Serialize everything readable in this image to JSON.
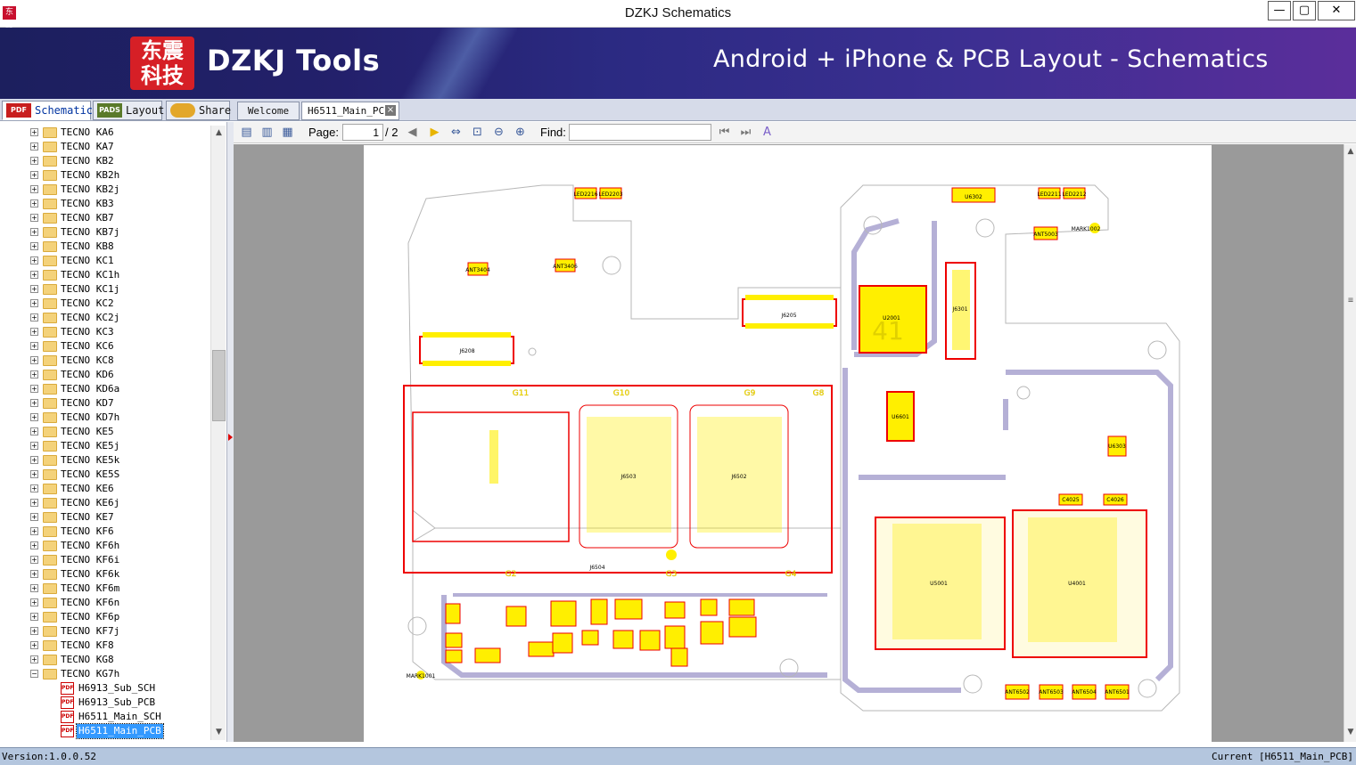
{
  "window": {
    "title": "DZKJ Schematics",
    "app_icon": "东震",
    "minimize": "—",
    "maximize": "▢",
    "close": "✕"
  },
  "banner": {
    "logo_text_line1": "东震",
    "logo_text_line2": "科技",
    "brand": "DZKJ Tools",
    "tagline": "Android + iPhone & PCB Layout - Schematics"
  },
  "left_tabs": [
    {
      "label": "Schematic",
      "icon": "PDF",
      "active": true
    },
    {
      "label": "Layout",
      "icon": "PADS"
    },
    {
      "label": "Share",
      "icon": "cloud"
    }
  ],
  "doc_tabs": [
    {
      "label": "Welcome"
    },
    {
      "label": "H6511_Main_PCB",
      "active": true
    }
  ],
  "tree": {
    "folders": [
      "TECNO KA6",
      "TECNO KA7",
      "TECNO KB2",
      "TECNO KB2h",
      "TECNO KB2j",
      "TECNO KB3",
      "TECNO KB7",
      "TECNO KB7j",
      "TECNO KB8",
      "TECNO KC1",
      "TECNO KC1h",
      "TECNO KC1j",
      "TECNO KC2",
      "TECNO KC2j",
      "TECNO KC3",
      "TECNO KC6",
      "TECNO KC8",
      "TECNO KD6",
      "TECNO KD6a",
      "TECNO KD7",
      "TECNO KD7h",
      "TECNO KE5",
      "TECNO KE5j",
      "TECNO KE5k",
      "TECNO KE5S",
      "TECNO KE6",
      "TECNO KE6j",
      "TECNO KE7",
      "TECNO KF6",
      "TECNO KF6h",
      "TECNO KF6i",
      "TECNO KF6k",
      "TECNO KF6m",
      "TECNO KF6n",
      "TECNO KF6p",
      "TECNO KF7j",
      "TECNO KF8",
      "TECNO KG8",
      "TECNO KG7h"
    ],
    "files": [
      "H6913_Sub_SCH",
      "H6913_Sub_PCB",
      "H6511_Main_SCH",
      "H6511_Main_PCB"
    ],
    "selected_file": "H6511_Main_PCB"
  },
  "toolbar": {
    "page_label": "Page:",
    "page_value": "1",
    "page_total": "/ 2",
    "find_label": "Find:",
    "find_value": ""
  },
  "pcb_labels": {
    "j6208": "J6208",
    "j6205": "J6205",
    "j6504": "J6504",
    "j6503": "J6503",
    "j6502": "J6502",
    "u4001": "U4001",
    "u5001": "U5001",
    "u6601": "U6601",
    "u2001": "U2001",
    "j6301": "J6301",
    "ant3404": "ANT3404",
    "ant3406": "ANT3406",
    "ant5003": "ANT5003",
    "led2216": "LED2216",
    "led2303": "LED2203",
    "led2211": "LED2211",
    "led2212": "LED2212",
    "mark1002": "MARK1002",
    "mark1001": "MARK1001",
    "u6302": "U6302",
    "g11": "G11",
    "g10": "G10",
    "g9": "G9",
    "g8": "G8",
    "g2": "G2",
    "g3": "G3",
    "g4": "G4",
    "u6303": "U6303",
    "c4025": "C4025",
    "c4026": "C4026",
    "n41": "41",
    "ant6502": "ANT6502",
    "ant6503": "ANT6503",
    "ant6504": "ANT6504",
    "ant6501": "ANT6501"
  },
  "status": {
    "version": "Version:1.0.0.52",
    "current": "Current [H6511_Main_PCB]"
  }
}
